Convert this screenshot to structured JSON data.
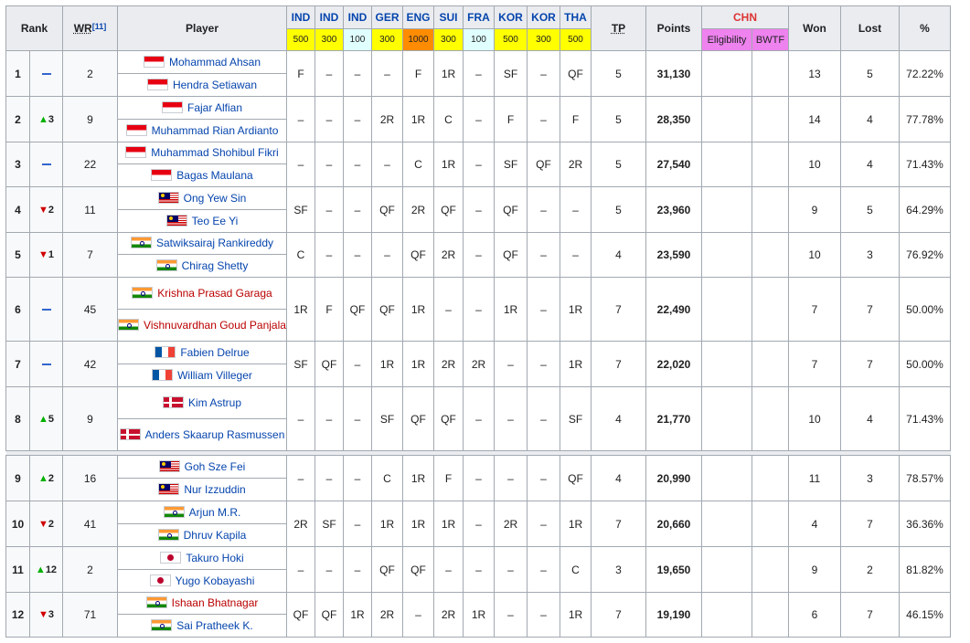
{
  "headers": {
    "rank": "Rank",
    "wr": "WR",
    "wr_ref": "[11]",
    "player": "Player",
    "tp": "TP",
    "points": "Points",
    "chn": "CHN",
    "eligibility": "Eligibility",
    "bwtf": "BWTF",
    "won": "Won",
    "lost": "Lost",
    "pct": "%"
  },
  "tournaments": [
    {
      "name": "IND",
      "level": "500",
      "level_color": "#ffff00"
    },
    {
      "name": "IND",
      "level": "300",
      "level_color": "#ffff00"
    },
    {
      "name": "IND",
      "level": "100",
      "level_color": "#e0ffff"
    },
    {
      "name": "GER",
      "level": "300",
      "level_color": "#ffff00"
    },
    {
      "name": "ENG",
      "level": "1000",
      "level_color": "#ff8c00"
    },
    {
      "name": "SUI",
      "level": "300",
      "level_color": "#ffff00"
    },
    {
      "name": "FRA",
      "level": "100",
      "level_color": "#e0ffff"
    },
    {
      "name": "KOR",
      "level": "500",
      "level_color": "#ffff00"
    },
    {
      "name": "KOR",
      "level": "300",
      "level_color": "#ffff00"
    },
    {
      "name": "THA",
      "level": "500",
      "level_color": "#ffff00"
    }
  ],
  "rows": [
    {
      "rank": "1",
      "move": "same",
      "move_val": "",
      "wr": "2",
      "players": [
        {
          "flag": "idn",
          "name": "Mohammad Ahsan"
        },
        {
          "flag": "idn",
          "name": "Hendra Setiawan"
        }
      ],
      "results": [
        "F",
        "–",
        "–",
        "–",
        "F",
        "1R",
        "–",
        "SF",
        "–",
        "QF"
      ],
      "tp": "5",
      "points": "31,130",
      "won": "13",
      "lost": "5",
      "pct": "72.22%"
    },
    {
      "rank": "2",
      "move": "up",
      "move_val": "3",
      "wr": "9",
      "players": [
        {
          "flag": "idn",
          "name": "Fajar Alfian"
        },
        {
          "flag": "idn",
          "name": "Muhammad Rian Ardianto"
        }
      ],
      "results": [
        "–",
        "–",
        "–",
        "2R",
        "1R",
        "C",
        "–",
        "F",
        "–",
        "F"
      ],
      "tp": "5",
      "points": "28,350",
      "won": "14",
      "lost": "4",
      "pct": "77.78%"
    },
    {
      "rank": "3",
      "move": "same",
      "move_val": "",
      "wr": "22",
      "players": [
        {
          "flag": "idn",
          "name": "Muhammad Shohibul Fikri"
        },
        {
          "flag": "idn",
          "name": "Bagas Maulana"
        }
      ],
      "results": [
        "–",
        "–",
        "–",
        "–",
        "C",
        "1R",
        "–",
        "SF",
        "QF",
        "2R"
      ],
      "tp": "5",
      "points": "27,540",
      "won": "10",
      "lost": "4",
      "pct": "71.43%"
    },
    {
      "rank": "4",
      "move": "down",
      "move_val": "2",
      "wr": "11",
      "players": [
        {
          "flag": "mas",
          "name": "Ong Yew Sin"
        },
        {
          "flag": "mas",
          "name": "Teo Ee Yi"
        }
      ],
      "results": [
        "SF",
        "–",
        "–",
        "QF",
        "2R",
        "QF",
        "–",
        "QF",
        "–",
        "–"
      ],
      "tp": "5",
      "points": "23,960",
      "won": "9",
      "lost": "5",
      "pct": "64.29%"
    },
    {
      "rank": "5",
      "move": "down",
      "move_val": "1",
      "wr": "7",
      "players": [
        {
          "flag": "ind",
          "name": "Satwiksairaj Rankireddy"
        },
        {
          "flag": "ind",
          "name": "Chirag Shetty"
        }
      ],
      "results": [
        "C",
        "–",
        "–",
        "–",
        "QF",
        "2R",
        "–",
        "QF",
        "–",
        "–"
      ],
      "tp": "4",
      "points": "23,590",
      "won": "10",
      "lost": "3",
      "pct": "76.92%"
    },
    {
      "rank": "6",
      "move": "same",
      "move_val": "",
      "wr": "45",
      "players": [
        {
          "flag": "ind",
          "name": "Krishna Prasad Garaga",
          "red": true
        },
        {
          "flag": "ind",
          "name": "Vishnuvardhan Goud Panjala",
          "red": true
        }
      ],
      "results": [
        "1R",
        "F",
        "QF",
        "QF",
        "1R",
        "–",
        "–",
        "1R",
        "–",
        "1R"
      ],
      "tp": "7",
      "points": "22,490",
      "won": "7",
      "lost": "7",
      "pct": "50.00%"
    },
    {
      "rank": "7",
      "move": "same",
      "move_val": "",
      "wr": "42",
      "players": [
        {
          "flag": "fra",
          "name": "Fabien Delrue"
        },
        {
          "flag": "fra",
          "name": "William Villeger"
        }
      ],
      "results": [
        "SF",
        "QF",
        "–",
        "1R",
        "1R",
        "2R",
        "2R",
        "–",
        "–",
        "1R"
      ],
      "tp": "7",
      "points": "22,020",
      "won": "7",
      "lost": "7",
      "pct": "50.00%"
    },
    {
      "rank": "8",
      "move": "up",
      "move_val": "5",
      "wr": "9",
      "players": [
        {
          "flag": "den",
          "name": "Kim Astrup"
        },
        {
          "flag": "den",
          "name": "Anders Skaarup Rasmussen"
        }
      ],
      "results": [
        "–",
        "–",
        "–",
        "SF",
        "QF",
        "QF",
        "–",
        "–",
        "–",
        "SF"
      ],
      "tp": "4",
      "points": "21,770",
      "won": "10",
      "lost": "4",
      "pct": "71.43%"
    },
    {
      "rank": "9",
      "move": "up",
      "move_val": "2",
      "wr": "16",
      "players": [
        {
          "flag": "mas",
          "name": "Goh Sze Fei"
        },
        {
          "flag": "mas",
          "name": "Nur Izzuddin"
        }
      ],
      "results": [
        "–",
        "–",
        "–",
        "C",
        "1R",
        "F",
        "–",
        "–",
        "–",
        "QF"
      ],
      "tp": "4",
      "points": "20,990",
      "won": "11",
      "lost": "3",
      "pct": "78.57%"
    },
    {
      "rank": "10",
      "move": "down",
      "move_val": "2",
      "wr": "41",
      "players": [
        {
          "flag": "ind",
          "name": "Arjun M.R."
        },
        {
          "flag": "ind",
          "name": "Dhruv Kapila"
        }
      ],
      "results": [
        "2R",
        "SF",
        "–",
        "1R",
        "1R",
        "1R",
        "–",
        "2R",
        "–",
        "1R"
      ],
      "tp": "7",
      "points": "20,660",
      "won": "4",
      "lost": "7",
      "pct": "36.36%"
    },
    {
      "rank": "11",
      "move": "up",
      "move_val": "12",
      "wr": "2",
      "players": [
        {
          "flag": "jpn",
          "name": "Takuro Hoki"
        },
        {
          "flag": "jpn",
          "name": "Yugo Kobayashi"
        }
      ],
      "results": [
        "–",
        "–",
        "–",
        "QF",
        "QF",
        "–",
        "–",
        "–",
        "–",
        "C"
      ],
      "tp": "3",
      "points": "19,650",
      "won": "9",
      "lost": "2",
      "pct": "81.82%"
    },
    {
      "rank": "12",
      "move": "down",
      "move_val": "3",
      "wr": "71",
      "players": [
        {
          "flag": "ind",
          "name": "Ishaan Bhatnagar",
          "red": true
        },
        {
          "flag": "ind",
          "name": "Sai Pratheek K."
        }
      ],
      "results": [
        "QF",
        "QF",
        "1R",
        "2R",
        "–",
        "2R",
        "1R",
        "–",
        "–",
        "1R"
      ],
      "tp": "7",
      "points": "19,190",
      "won": "6",
      "lost": "7",
      "pct": "46.15%"
    }
  ]
}
